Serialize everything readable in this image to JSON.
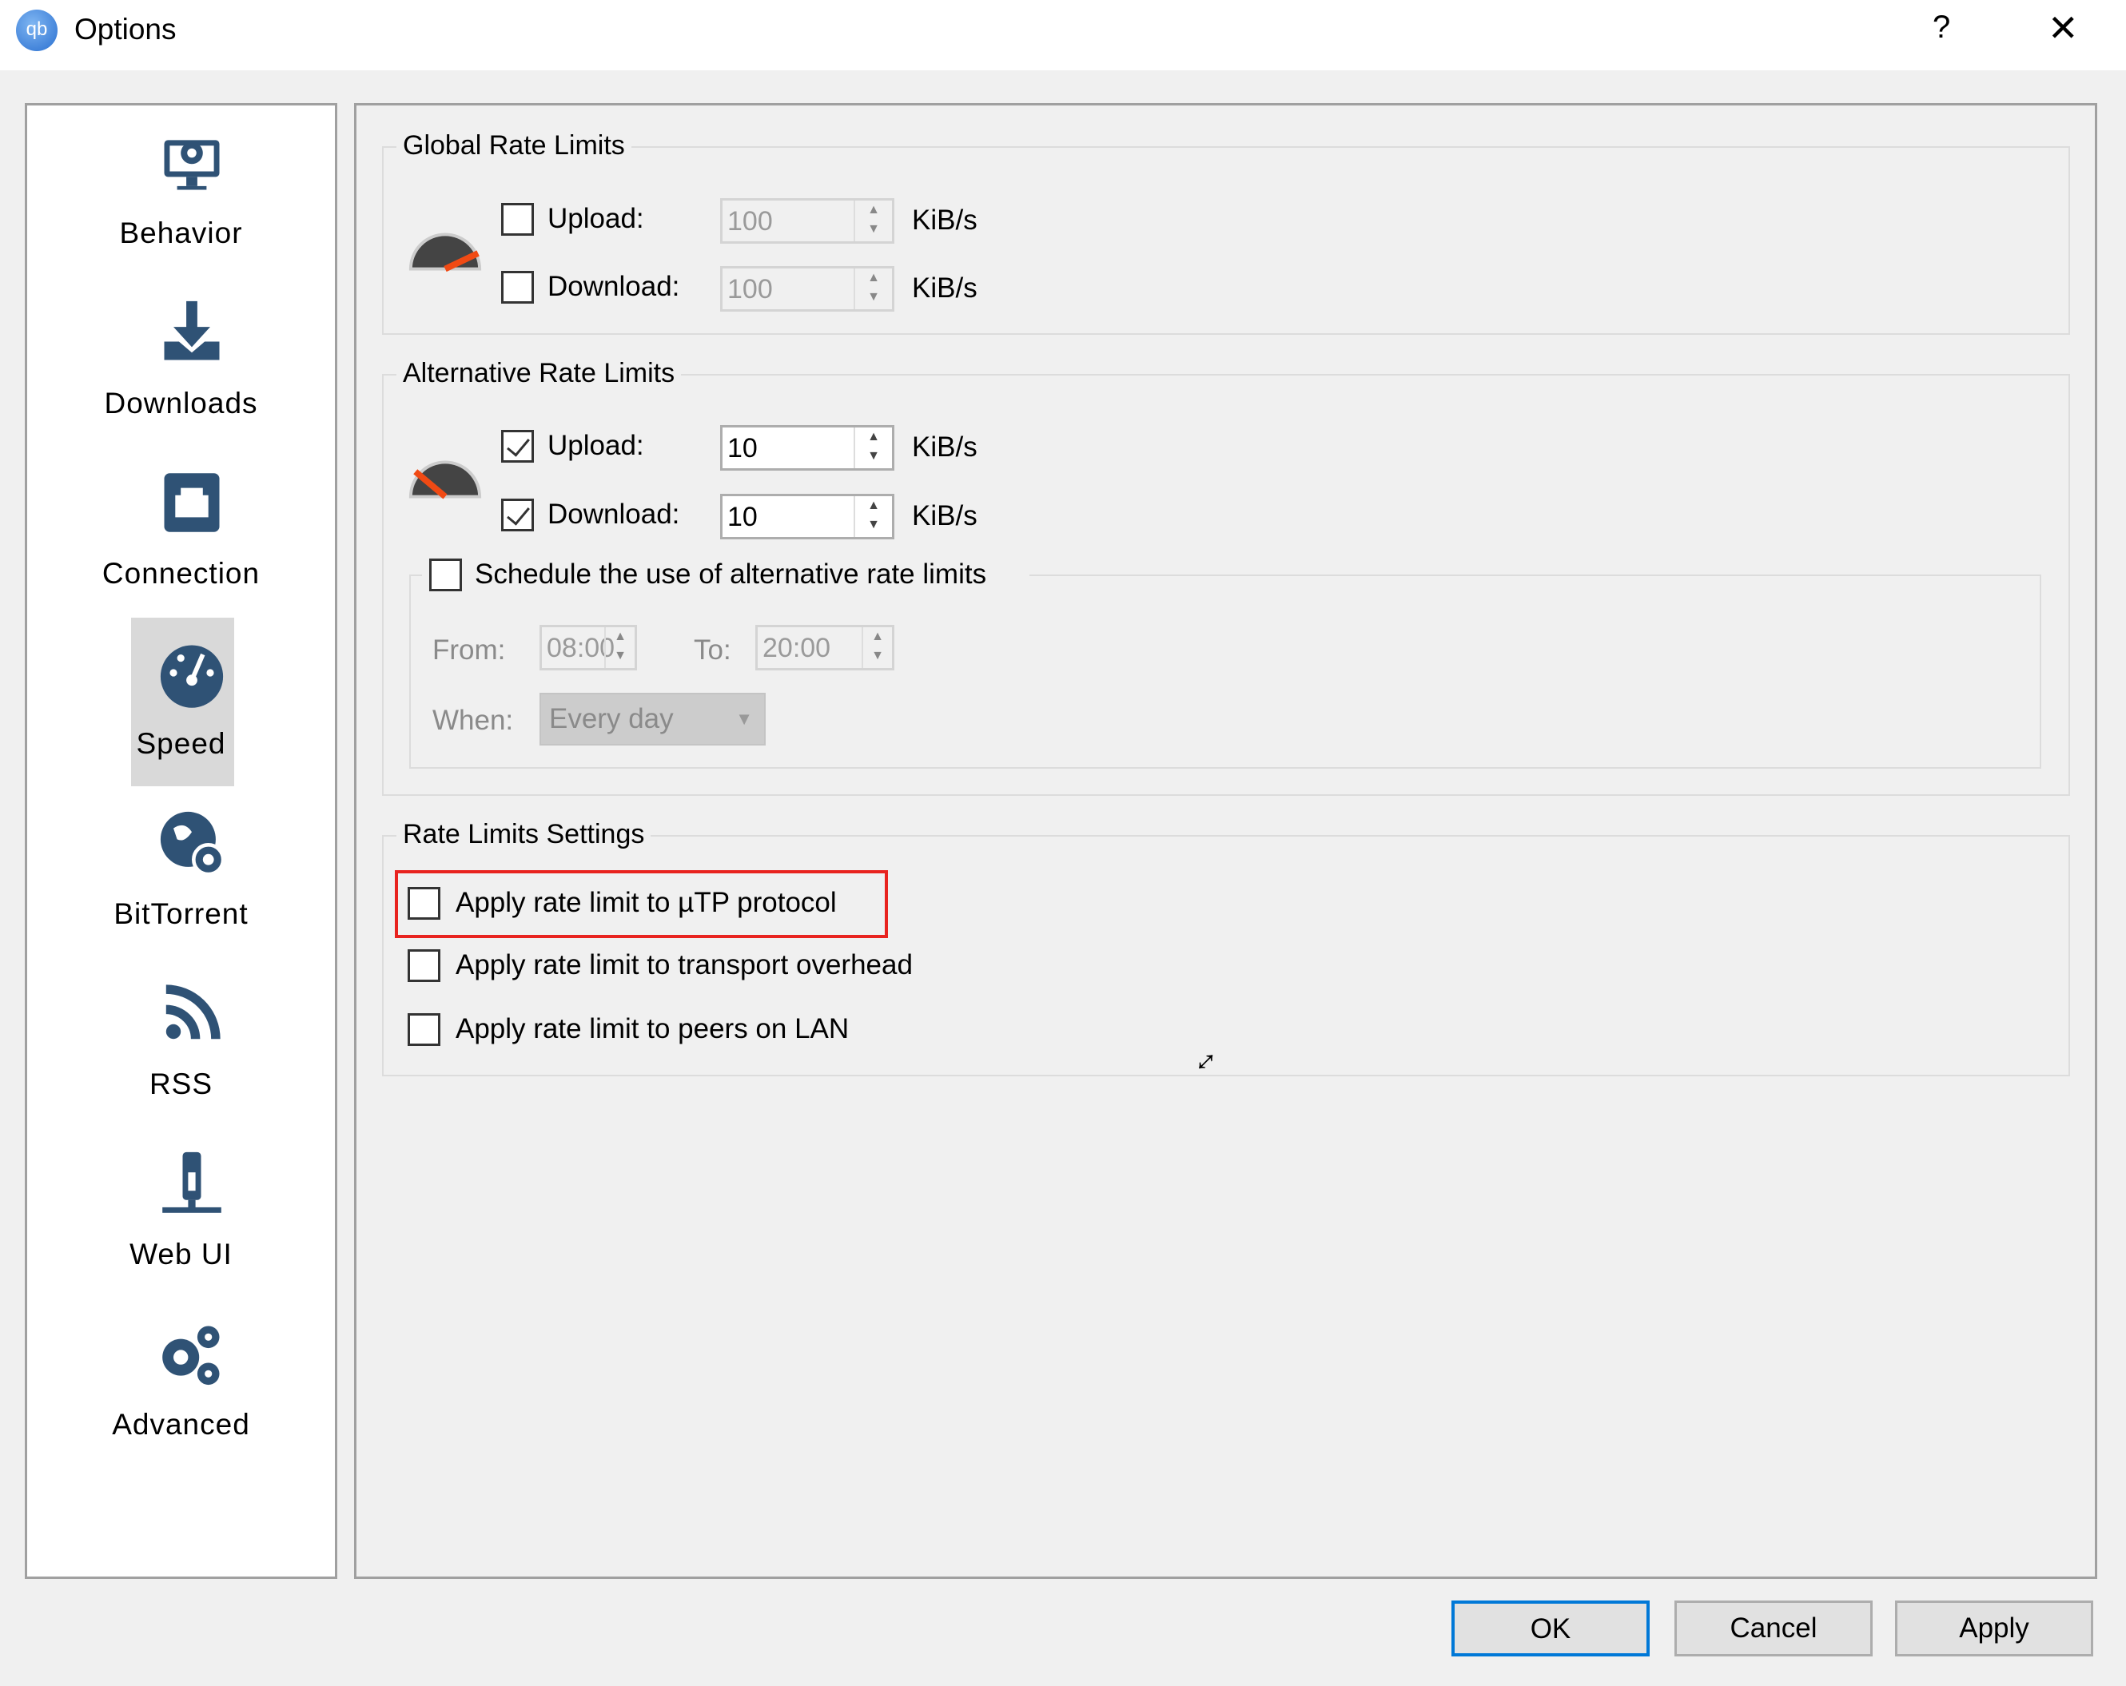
{
  "window": {
    "title": "Options",
    "help": "?",
    "close": "✕"
  },
  "sidebar": {
    "items": [
      {
        "label": "Behavior",
        "icon": "monitor-gear-icon"
      },
      {
        "label": "Downloads",
        "icon": "download-icon"
      },
      {
        "label": "Connection",
        "icon": "network-port-icon"
      },
      {
        "label": "Speed",
        "icon": "speedometer-icon",
        "selected": true
      },
      {
        "label": "BitTorrent",
        "icon": "globe-gear-icon"
      },
      {
        "label": "RSS",
        "icon": "rss-icon"
      },
      {
        "label": "Web UI",
        "icon": "web-ui-icon"
      },
      {
        "label": "Advanced",
        "icon": "gears-icon"
      }
    ]
  },
  "global": {
    "title": "Global Rate Limits",
    "upload_label": "Upload:",
    "upload_value": "100",
    "upload_checked": false,
    "download_label": "Download:",
    "download_value": "100",
    "download_checked": false,
    "unit": "KiB/s"
  },
  "alternative": {
    "title": "Alternative Rate Limits",
    "upload_label": "Upload:",
    "upload_value": "10",
    "upload_checked": true,
    "download_label": "Download:",
    "download_value": "10",
    "download_checked": true,
    "unit": "KiB/s",
    "schedule": {
      "label": "Schedule the use of alternative rate limits",
      "checked": false,
      "from_label": "From:",
      "from_value": "08:00",
      "to_label": "To:",
      "to_value": "20:00",
      "when_label": "When:",
      "when_value": "Every day"
    }
  },
  "settings": {
    "title": "Rate Limits Settings",
    "options": [
      {
        "label": "Apply rate limit to µTP protocol",
        "checked": false,
        "highlighted": true
      },
      {
        "label": "Apply rate limit to transport overhead",
        "checked": false
      },
      {
        "label": "Apply rate limit to peers on LAN",
        "checked": false
      }
    ]
  },
  "highlight_color": "#e8231f",
  "icon_color": "#2f5275",
  "buttons": {
    "ok": "OK",
    "cancel": "Cancel",
    "apply": "Apply"
  }
}
